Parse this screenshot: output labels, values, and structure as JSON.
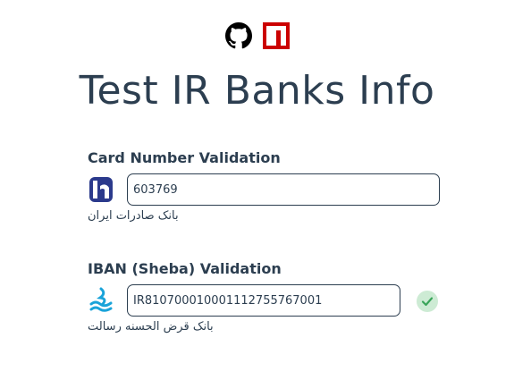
{
  "header": {
    "github_icon": "github-icon",
    "npm_icon": "npm-icon",
    "title": "Test IR Banks Info"
  },
  "card": {
    "label": "Card Number Validation",
    "input_value": "603769",
    "bank_name": "بانک صادرات ایران",
    "bank_logo": "bank-saderat-icon",
    "logo_color": "#2b3a8c"
  },
  "iban": {
    "label": "IBAN (Sheba) Validation",
    "input_value": "IR810700010001112755767001",
    "bank_name": "بانک قرض الحسنه رسالت",
    "bank_logo": "bank-resalat-icon",
    "logo_color": "#1aa3d9",
    "status": "valid",
    "status_icon": "check-icon",
    "status_color": "#3aa55a"
  }
}
